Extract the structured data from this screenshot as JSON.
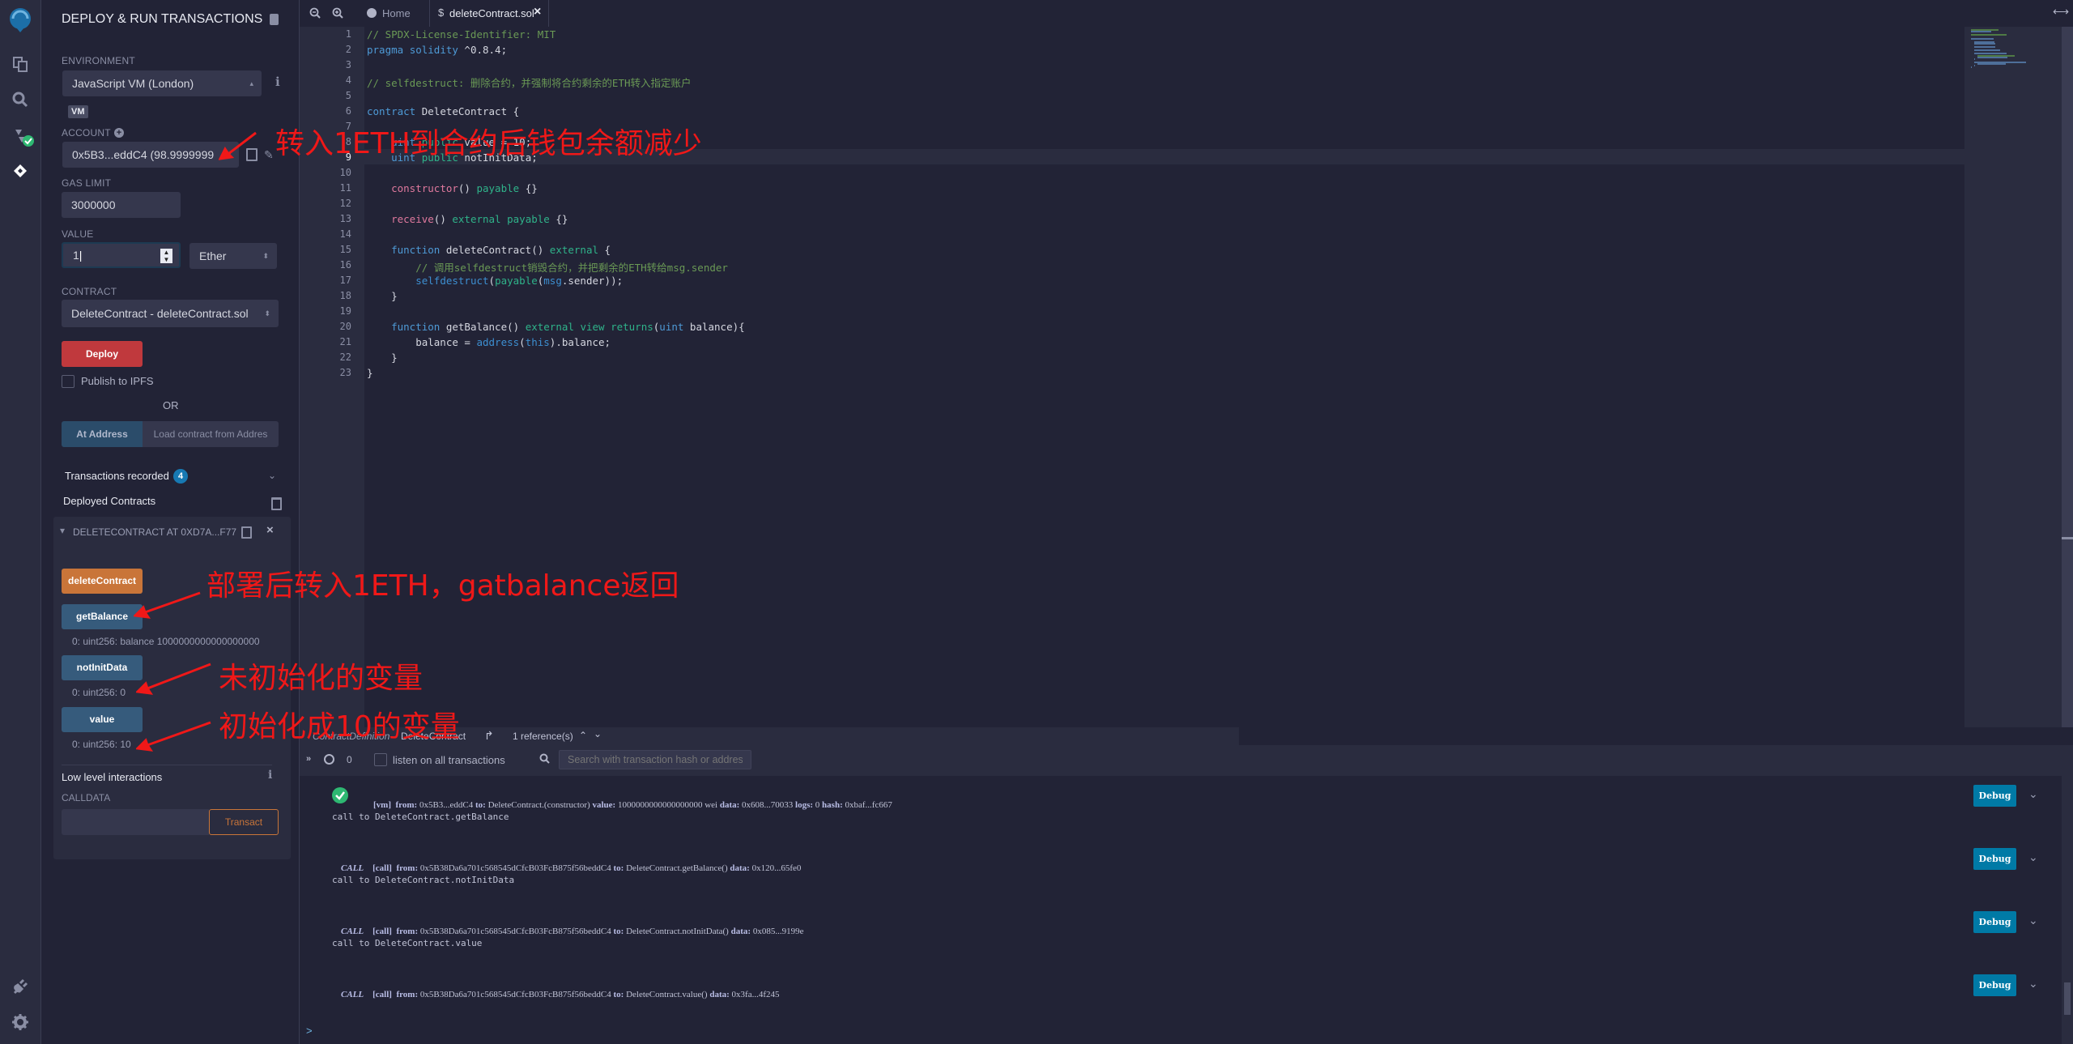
{
  "iconbar": {
    "icons": [
      "remix-logo-icon",
      "file-explorer-icon",
      "search-icon",
      "solidity-compiler-icon",
      "deploy-run-icon",
      "plugin-manager-icon",
      "settings-icon"
    ]
  },
  "side": {
    "title": "DEPLOY & RUN TRANSACTIONS",
    "environment_label": "ENVIRONMENT",
    "environment_value": "JavaScript VM (London)",
    "vm_badge": "VM",
    "account_label": "ACCOUNT",
    "account_value": "0x5B3...eddC4 (98.9999999",
    "gas_limit_label": "GAS LIMIT",
    "gas_limit_value": "3000000",
    "value_label": "VALUE",
    "value_value": "1",
    "value_unit": "Ether",
    "contract_label": "CONTRACT",
    "contract_value": "DeleteContract - deleteContract.sol",
    "deploy_label": "Deploy",
    "publish_ipfs_label": "Publish to IPFS",
    "or_label": "OR",
    "at_address_label": "At Address",
    "load_contract_placeholder": "Load contract from Addres",
    "transactions_recorded_label": "Transactions recorded",
    "transactions_recorded_count": "4",
    "deployed_contracts_label": "Deployed Contracts",
    "instance_title": "DELETECONTRACT AT 0XD7A...F77",
    "functions": [
      {
        "label": "deleteContract",
        "output": ""
      },
      {
        "label": "getBalance",
        "output": "0: uint256: balance 1000000000000000000"
      },
      {
        "label": "notInitData",
        "output": "0: uint256: 0"
      },
      {
        "label": "value",
        "output": "0: uint256: 10"
      }
    ],
    "low_level_label": "Low level interactions",
    "calldata_label": "CALLDATA",
    "calldata_value": "",
    "transact_label": "Transact"
  },
  "editor": {
    "tabs": [
      {
        "label": "Home",
        "active": false
      },
      {
        "label": "deleteContract.sol",
        "active": true
      }
    ],
    "lines": [
      "// SPDX-License-Identifier: MIT",
      "pragma solidity ^0.8.4;",
      "",
      "// selfdestruct: 删除合约，并强制将合约剩余的ETH转入指定账户",
      "",
      "contract DeleteContract {",
      "",
      "    uint public value = 10;",
      "    uint public notInitData;",
      "",
      "    constructor() payable {}",
      "",
      "    receive() external payable {}",
      "",
      "    function deleteContract() external {",
      "        // 调用selfdestruct销毁合约，并把剩余的ETH转给msg.sender",
      "        selfdestruct(payable(msg.sender));",
      "    }",
      "",
      "    function getBalance() external view returns(uint balance){",
      "        balance = address(this).balance;",
      "    }",
      "}"
    ],
    "current_line": 9,
    "reference_bar": {
      "kind": "ContractDefinition",
      "name": "DeleteContract",
      "references": "1 reference(s)"
    }
  },
  "terminal": {
    "pending_count": "0",
    "listen_label": "listen on all transactions",
    "search_placeholder": "Search with transaction hash or address",
    "debug_label": "Debug",
    "entries": [
      {
        "type": "vm",
        "tag": "[vm]",
        "from": "0x5B3...eddC4",
        "to": "DeleteContract.(constructor)",
        "value": "1000000000000000000 wei",
        "data": "0x608...70033",
        "logs": "0",
        "hash": "0xbaf...fc667",
        "status": "success"
      },
      {
        "type": "info",
        "text": "call to DeleteContract.getBalance"
      },
      {
        "type": "call",
        "badge": "CALL",
        "tag": "[call]",
        "from": "0x5B38Da6a701c568545dCfcB03FcB875f56beddC4",
        "to": "DeleteContract.getBalance()",
        "data": "0x120...65fe0"
      },
      {
        "type": "info",
        "text": "call to DeleteContract.notInitData"
      },
      {
        "type": "call",
        "badge": "CALL",
        "tag": "[call]",
        "from": "0x5B38Da6a701c568545dCfcB03FcB875f56beddC4",
        "to": "DeleteContract.notInitData()",
        "data": "0x085...9199e"
      },
      {
        "type": "info",
        "text": "call to DeleteContract.value"
      },
      {
        "type": "call",
        "badge": "CALL",
        "tag": "[call]",
        "from": "0x5B38Da6a701c568545dCfcB03FcB875f56beddC4",
        "to": "DeleteContract.value()",
        "data": "0x3fa...4f245"
      }
    ],
    "labels": {
      "from": "from:",
      "to": "to:",
      "value": "value:",
      "data": "data:",
      "logs": "logs:",
      "hash": "hash:"
    },
    "prompt": ">"
  },
  "annotations": [
    "转入1ETH到合约后钱包余额减少",
    "部署后转入1ETH，gatbalance返回",
    "未初始化的变量",
    "初始化成10的变量"
  ],
  "colors": {
    "deploy": "#c0393d",
    "deleteContract_btn": "#c97539",
    "call_btn": "#365b7c",
    "debug_btn": "#007aa6",
    "annotation": "#f01818",
    "badge": "#007aa6"
  }
}
